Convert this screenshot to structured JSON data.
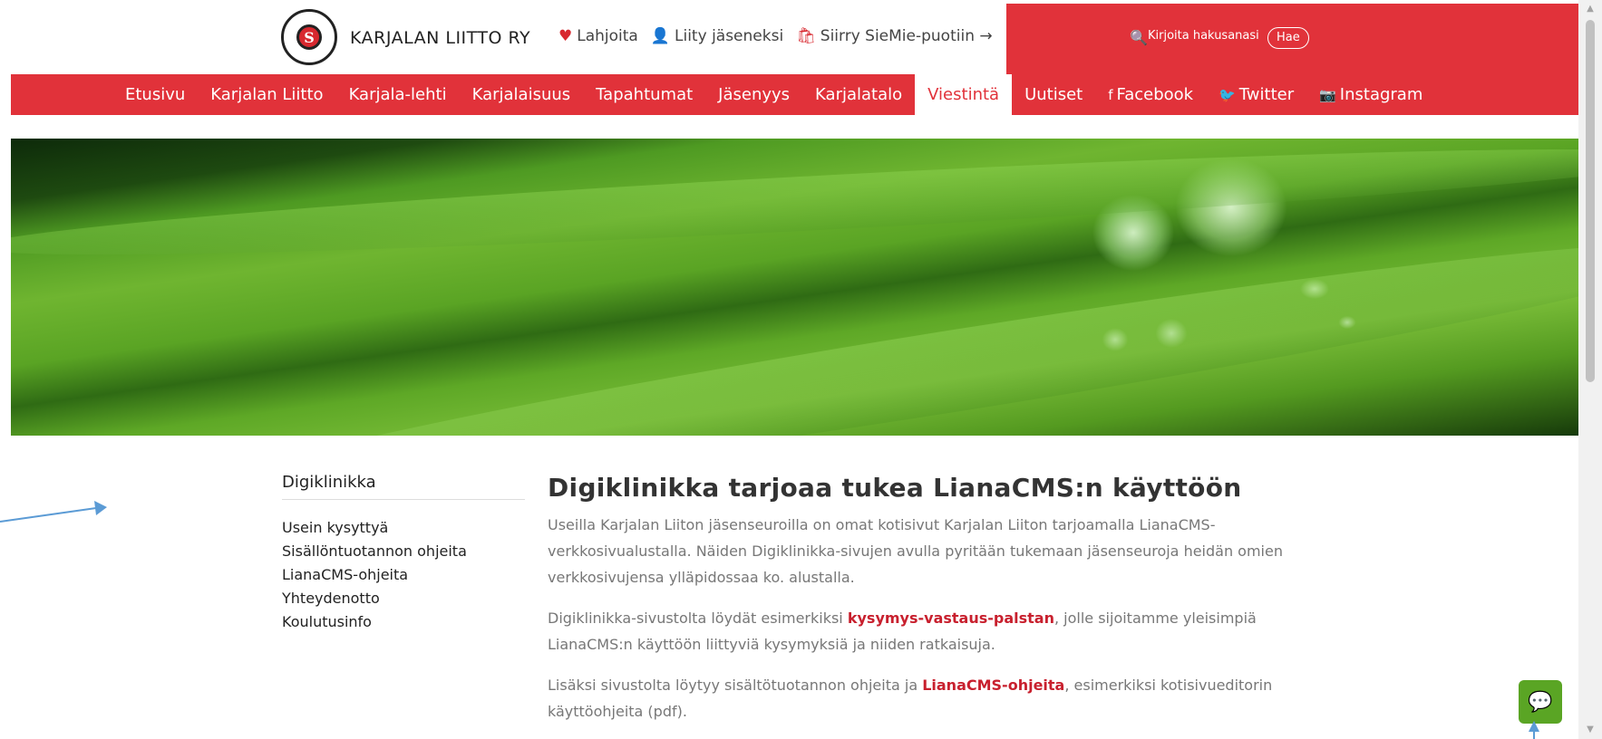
{
  "header": {
    "site_name": "KARJALAN LIITTO RY",
    "logo_text": "KARJALAN LIITTO",
    "top_links": [
      {
        "icon": "heart-icon",
        "glyph": "♥",
        "label": "Lahjoita"
      },
      {
        "icon": "add-user-icon",
        "glyph": "👤",
        "label": "Liity jäseneksi"
      },
      {
        "icon": "shopping-bag-icon",
        "glyph": "🛍",
        "label": "Siirry SieMie-puotiin →"
      }
    ],
    "search": {
      "placeholder": "Kirjoita hakusanasi",
      "button": "Hae"
    }
  },
  "nav": {
    "items": [
      "Etusivu",
      "Karjalan Liitto",
      "Karjala-lehti",
      "Karjalaisuus",
      "Tapahtumat",
      "Jäsenyys",
      "Karjalatalo",
      "Viestintä",
      "Uutiset"
    ],
    "active": "Viestintä",
    "social": [
      {
        "icon": "facebook-icon",
        "glyph": "f",
        "label": "Facebook"
      },
      {
        "icon": "twitter-icon",
        "glyph": "🐦",
        "label": "Twitter"
      },
      {
        "icon": "instagram-icon",
        "glyph": "📷",
        "label": "Instagram"
      }
    ]
  },
  "sidebar": {
    "title": "Digiklinikka",
    "items": [
      "Usein kysyttyä",
      "Sisällöntuotannon ohjeita",
      "LianaCMS-ohjeita",
      "Yhteydenotto",
      "Koulutusinfo"
    ]
  },
  "main": {
    "title": "Digiklinikka tarjoaa tukea LianaCMS:n käyttöön",
    "p1": "Useilla Karjalan Liiton jäsenseuroilla on omat kotisivut Karjalan Liiton tarjoamalla LianaCMS-verkkosivualustalla. Näiden Digiklinikka-sivujen avulla pyritään tukemaan jäsenseuroja heidän omien verkkosivujensa ylläpidossaa ko. alustalla.",
    "p2_before": "Digiklinikka-sivustolta löydät esimerkiksi ",
    "p2_link": "kysymys-vastaus-palstan",
    "p2_after": ", jolle sijoitamme yleisimpiä LianaCMS:n käyttöön liittyviä kysymyksiä ja niiden ratkaisuja.",
    "p3_before": "Lisäksi sivustolta löytyy sisältötuotannon ohjeita ja ",
    "p3_link": "LianaCMS-ohjeita",
    "p3_after": ", esimerkiksi kotisivueditorin käyttöohjeita (pdf)."
  },
  "chat": {
    "icon": "chat-icon",
    "glyph": "💬"
  },
  "colors": {
    "brand_red": "#e1323a",
    "link_red": "#c8202e",
    "chat_green": "#5aa524"
  }
}
